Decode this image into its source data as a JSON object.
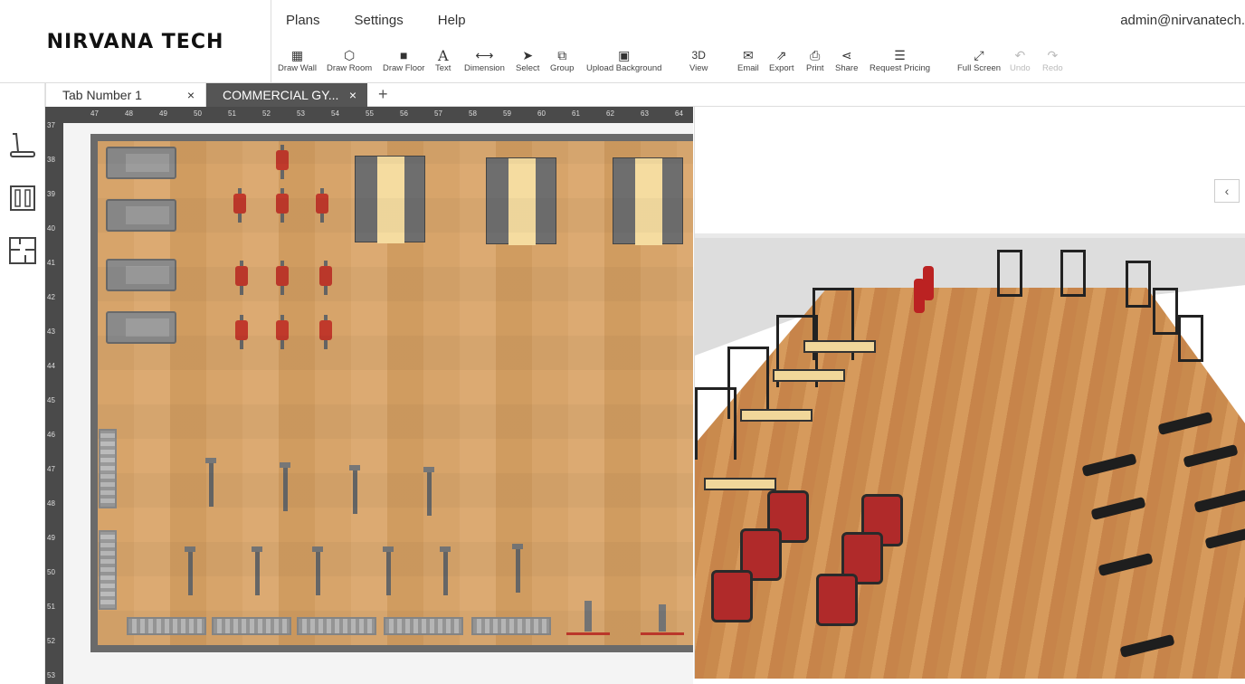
{
  "logo": {
    "text": "NIRVANA TECH"
  },
  "menu": [
    {
      "label": "Plans"
    },
    {
      "label": "Settings"
    },
    {
      "label": "Help"
    }
  ],
  "user": {
    "email": "admin@nirvanatech."
  },
  "toolbar": [
    {
      "label": "Draw Wall",
      "icon": "brick-wall-icon",
      "enabled": true
    },
    {
      "label": "Draw Room",
      "icon": "cube-icon",
      "enabled": true
    },
    {
      "label": "Draw Floor",
      "icon": "floor-square-icon",
      "enabled": true
    },
    {
      "label": "Text",
      "icon": "letter-a-icon",
      "enabled": true
    },
    {
      "label": "Dimension",
      "icon": "double-arrow-icon",
      "enabled": true
    },
    {
      "label": "Select",
      "icon": "cursor-arrow-icon",
      "enabled": true
    },
    {
      "label": "Group",
      "icon": "group-icon",
      "enabled": true
    },
    {
      "label": "Upload Background",
      "icon": "image-icon",
      "enabled": true
    },
    {
      "label": "View",
      "glyph": "3D",
      "enabled": true
    },
    {
      "label": "Email",
      "icon": "envelope-icon",
      "enabled": true
    },
    {
      "label": "Export",
      "icon": "export-icon",
      "enabled": true
    },
    {
      "label": "Print",
      "icon": "printer-icon",
      "enabled": true
    },
    {
      "label": "Share",
      "icon": "share-icon",
      "enabled": true
    },
    {
      "label": "Request Pricing",
      "icon": "hamburger-icon",
      "enabled": true
    },
    {
      "label": "Full Screen",
      "icon": "expand-icon",
      "enabled": true
    },
    {
      "label": "Undo",
      "icon": "undo-icon",
      "enabled": false
    },
    {
      "label": "Redo",
      "icon": "redo-icon",
      "enabled": false
    }
  ],
  "leftbar": [
    {
      "icon": "treadmill-icon"
    },
    {
      "icon": "rack-icon"
    },
    {
      "icon": "floorplan-icon"
    }
  ],
  "tabs": [
    {
      "label": "Tab Number 1",
      "active": false
    },
    {
      "label": "COMMERCIAL GY...",
      "active": true
    }
  ],
  "tab_close": "×",
  "tab_add": "+",
  "ruler": {
    "top": [
      "47",
      "48",
      "49",
      "50",
      "51",
      "52",
      "53",
      "54",
      "55",
      "56",
      "57",
      "58",
      "59",
      "60",
      "61",
      "62",
      "63",
      "64"
    ],
    "left": [
      "37",
      "38",
      "39",
      "40",
      "41",
      "42",
      "43",
      "44",
      "45",
      "46",
      "47",
      "48",
      "49",
      "50",
      "51",
      "52",
      "53"
    ]
  },
  "view3d": {
    "collapse": "‹"
  },
  "colors": {
    "accent_red": "#c0392b",
    "floor_wood": "#d6a468",
    "tab_active_bg": "#555555"
  }
}
